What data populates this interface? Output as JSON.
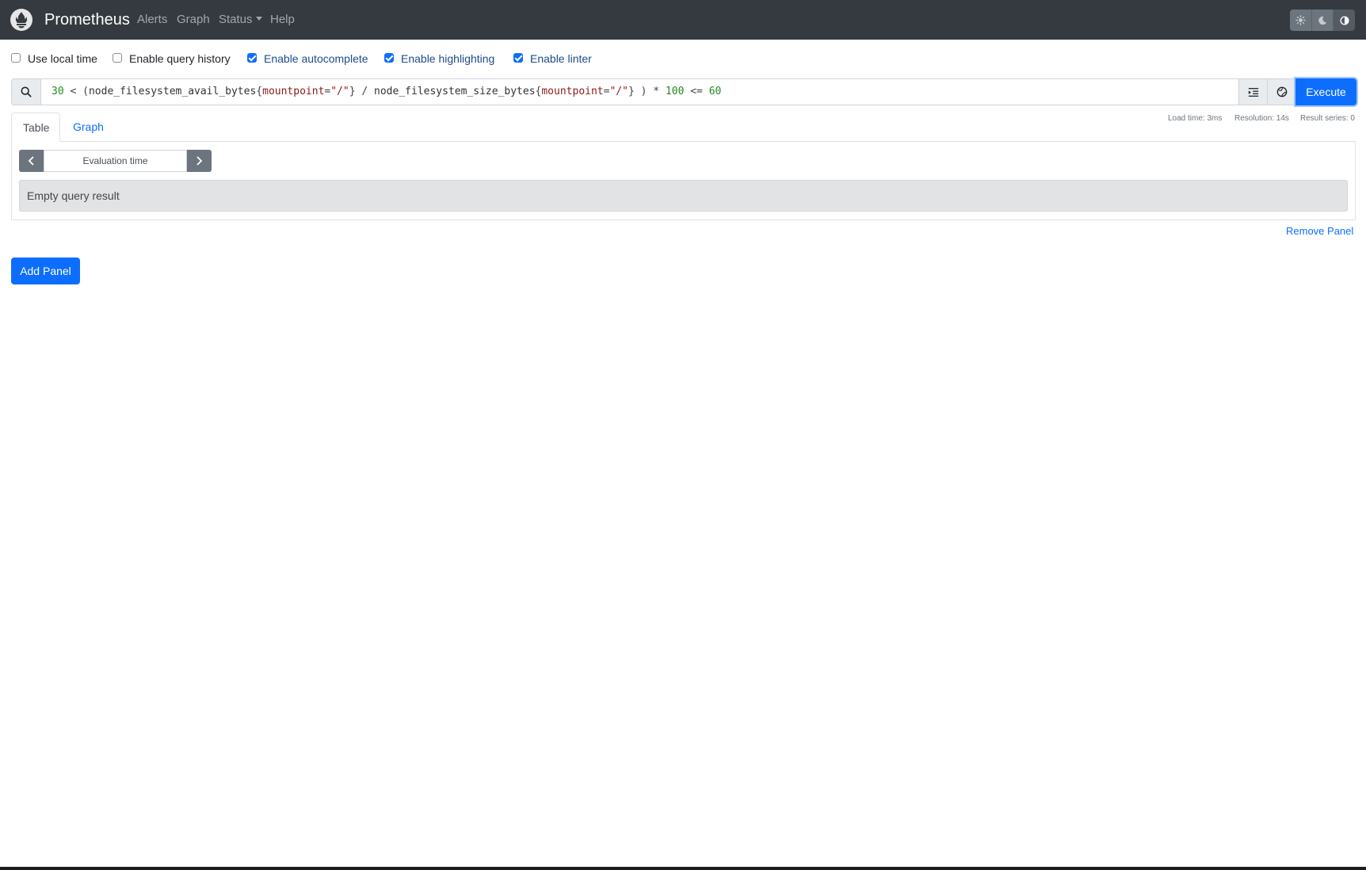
{
  "navbar": {
    "brand": "Prometheus",
    "links": {
      "alerts": "Alerts",
      "graph": "Graph",
      "status": "Status",
      "help": "Help"
    },
    "icons": {
      "logo": "prometheus-logo",
      "theme_light": "sun-icon",
      "theme_dark": "moon-icon",
      "theme_auto": "contrast-icon"
    },
    "colors": {
      "background": "#343a40"
    }
  },
  "options": {
    "use_local_time": {
      "label": "Use local time",
      "checked": false
    },
    "enable_query_history": {
      "label": "Enable query history",
      "checked": false
    },
    "enable_autocomplete": {
      "label": "Enable autocomplete",
      "checked": true
    },
    "enable_highlighting": {
      "label": "Enable highlighting",
      "checked": true
    },
    "enable_linter": {
      "label": "Enable linter",
      "checked": true
    }
  },
  "query": {
    "expression": "30 < (node_filesystem_avail_bytes{mountpoint=\"/\"} / node_filesystem_size_bytes{mountpoint=\"/\"} ) * 100 <= 60",
    "tokens": {
      "n30": "30",
      "lt": " < (",
      "m1": "node_filesystem_avail_bytes",
      "b1": "{",
      "l1": "mountpoint",
      "eq1": "=",
      "s1": "\"/\"",
      "c1": "}",
      "div": " / ",
      "m2": "node_filesystem_size_bytes",
      "b2": "{",
      "l2": "mountpoint",
      "eq2": "=",
      "s2": "\"/\"",
      "c2": "}",
      "mul": " ) * ",
      "n100": "100",
      "le": " <= ",
      "n60": "60"
    },
    "execute_label": "Execute",
    "icons": {
      "search": "search-icon",
      "format": "format-indent-icon",
      "explore": "metrics-explorer-icon"
    }
  },
  "stats": {
    "load_time": "Load time: 3ms",
    "resolution": "Resolution: 14s",
    "result_series": "Result series: 0"
  },
  "tabs": {
    "table": "Table",
    "graph": "Graph",
    "active": "Table"
  },
  "table_panel": {
    "evaluation_time_placeholder": "Evaluation time",
    "empty_result": "Empty query result"
  },
  "actions": {
    "remove_panel": "Remove Panel",
    "add_panel": "Add Panel"
  },
  "colors": {
    "primary": "#0d6efd",
    "secondary": "#6c757d",
    "alert_bg": "#e2e3e5"
  }
}
